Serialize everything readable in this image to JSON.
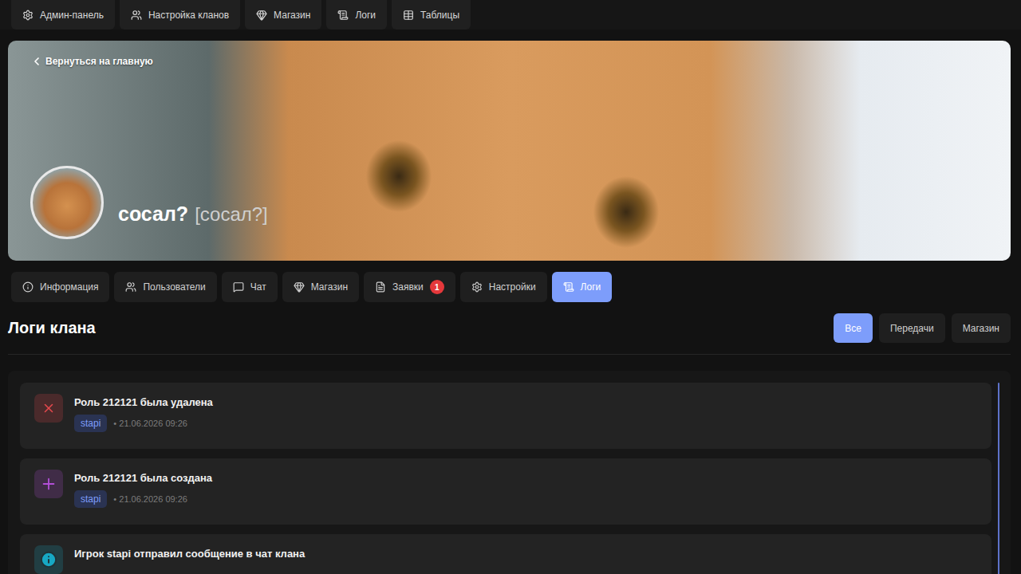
{
  "top_nav": [
    {
      "label": "Админ-панель"
    },
    {
      "label": "Настройка кланов"
    },
    {
      "label": "Магазин"
    },
    {
      "label": "Логи"
    },
    {
      "label": "Таблицы"
    }
  ],
  "banner": {
    "back_link": "Вернуться на главную",
    "clan_name": "сосал?",
    "clan_tag": "[сосал?]"
  },
  "tabs": [
    {
      "label": "Информация",
      "selected": false
    },
    {
      "label": "Пользователи",
      "selected": false
    },
    {
      "label": "Чат",
      "selected": false
    },
    {
      "label": "Магазин",
      "selected": false
    },
    {
      "label": "Заявки",
      "selected": false,
      "badge": "1"
    },
    {
      "label": "Настройки",
      "selected": false
    },
    {
      "label": "Логи",
      "selected": true
    }
  ],
  "section": {
    "title": "Логи клана"
  },
  "filters": [
    {
      "label": "Все",
      "selected": true
    },
    {
      "label": "Передачи",
      "selected": false
    },
    {
      "label": "Магазин",
      "selected": false
    }
  ],
  "logs": [
    {
      "kind": "deleted",
      "color": "#e5484d",
      "title": "Роль 212121 была удалена",
      "author": "stapi",
      "time": "• 21.06.2026 09:26"
    },
    {
      "kind": "created",
      "color": "#b24fd8",
      "title": "Роль 212121 была создана",
      "author": "stapi",
      "time": "• 21.06.2026 09:26"
    },
    {
      "kind": "info",
      "color": "#17a8c4",
      "title": "Игрок stapi отправил сообщение в чат клана"
    }
  ]
}
